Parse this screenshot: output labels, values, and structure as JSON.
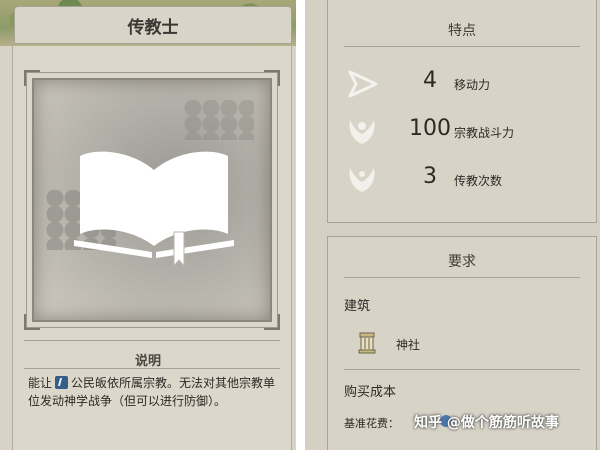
{
  "left_card": {
    "title": "传教士",
    "description_header": "说明",
    "description_before_icon": "能让",
    "description_after_icon": "公民皈依所属宗教。无法对其他宗教单位发动神学战争（但可以进行防御）。"
  },
  "right_panel": {
    "features_title": "特点",
    "stats": [
      {
        "icon": "movement-arrow-icon",
        "value": "4",
        "label": "移动力"
      },
      {
        "icon": "religious-strength-icon",
        "value": "100",
        "label": "宗教战斗力"
      },
      {
        "icon": "spread-religion-icon",
        "value": "3",
        "label": "传教次数"
      }
    ],
    "requirements_title": "要求",
    "building_label": "建筑",
    "building_name": "神社",
    "purchase_label": "购买成本",
    "base_cost_label": "基准花费："
  },
  "watermark": "知乎 @做个筋筋听故事",
  "colors": {
    "panel_bg": "#d8d3c6",
    "border": "#a8a294",
    "text": "#2d2a26",
    "faith_blue": "#355d8a"
  }
}
